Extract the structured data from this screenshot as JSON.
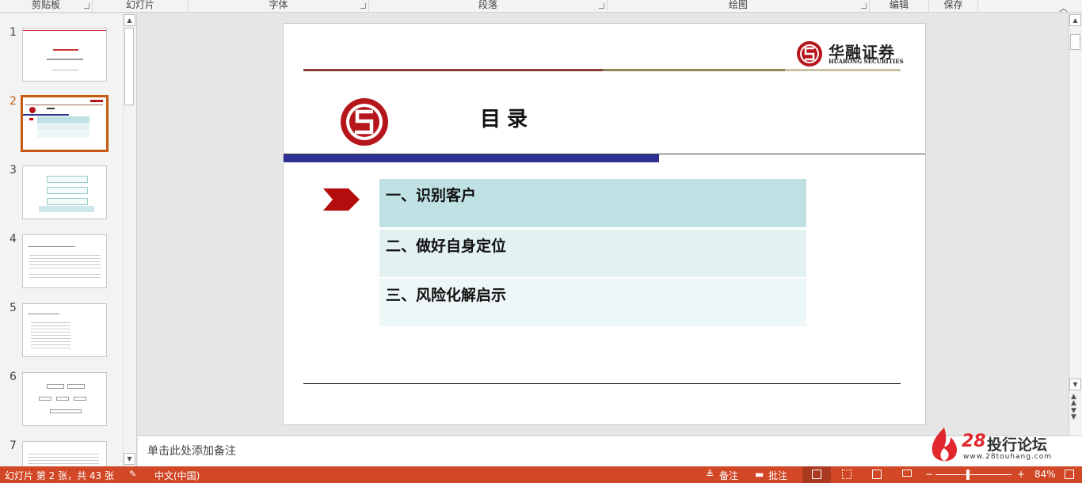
{
  "ribbon": {
    "groups": [
      "剪贴板",
      "幻灯片",
      "字体",
      "段落",
      "绘图",
      "编辑",
      "保存"
    ]
  },
  "thumbnails": {
    "selected_index": 2,
    "numbers": [
      "1",
      "2",
      "3",
      "4",
      "5",
      "6",
      "7"
    ]
  },
  "slide": {
    "brand_name": "华融证券",
    "brand_sub": "HUARONG SECURITIES",
    "title": "目录",
    "items": [
      "一、识别客户",
      "二、做好自身定位",
      "三、风险化解启示"
    ]
  },
  "notes": {
    "placeholder": "单击此处添加备注"
  },
  "status": {
    "slide_count": "幻灯片 第 2 张，共 43 张",
    "language": "中文(中国)",
    "notes_label": "备注",
    "comments_label": "批注",
    "zoom": "84%"
  },
  "watermark": {
    "number": "28",
    "name": "投行论坛",
    "url": "www.28touhang.com"
  },
  "colors": {
    "accent": "#c55a11",
    "status_bar": "#d24726",
    "brand_red": "#b5161b",
    "blue_bar": "#2e3192"
  }
}
